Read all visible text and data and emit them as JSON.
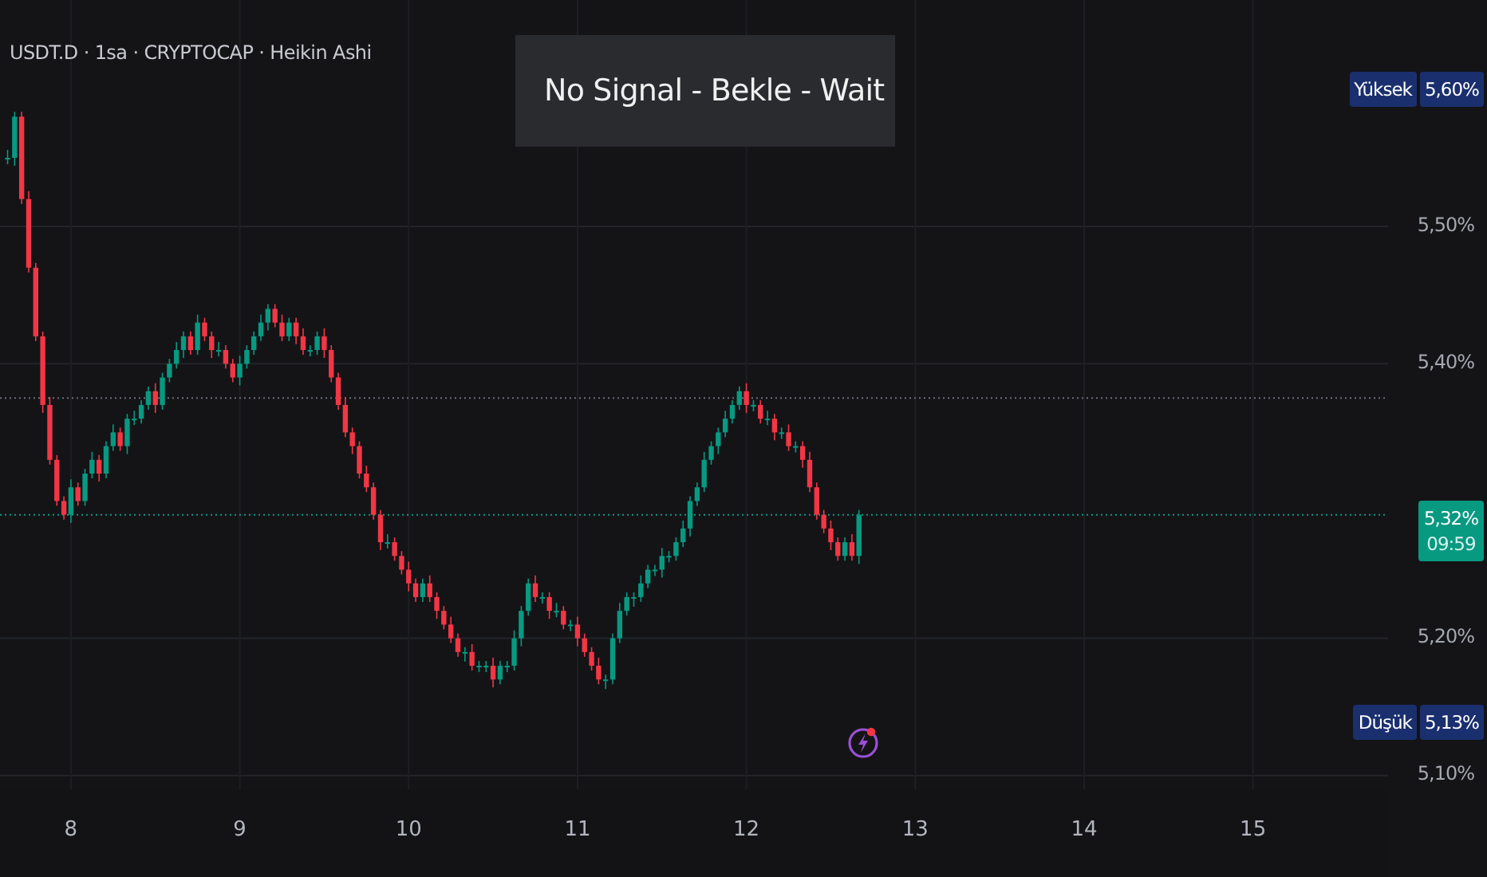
{
  "header": {
    "symbol_line": "USDT.D · 1sa · CRYPTOCAP · Heikin Ashi"
  },
  "signal_box": {
    "text": "No Signal - Bekle - Wait"
  },
  "price_axis": {
    "ticks": [
      "5,50%",
      "5,40%",
      "5,20%",
      "5,10%"
    ],
    "high": {
      "label": "Yüksek",
      "value": "5,60%"
    },
    "low": {
      "label": "Düşük",
      "value": "5,13%"
    },
    "current": {
      "value": "5,32%",
      "countdown": "09:59"
    }
  },
  "time_axis": {
    "ticks": [
      "8",
      "9",
      "10",
      "11",
      "12",
      "13",
      "14",
      "15"
    ]
  }
}
